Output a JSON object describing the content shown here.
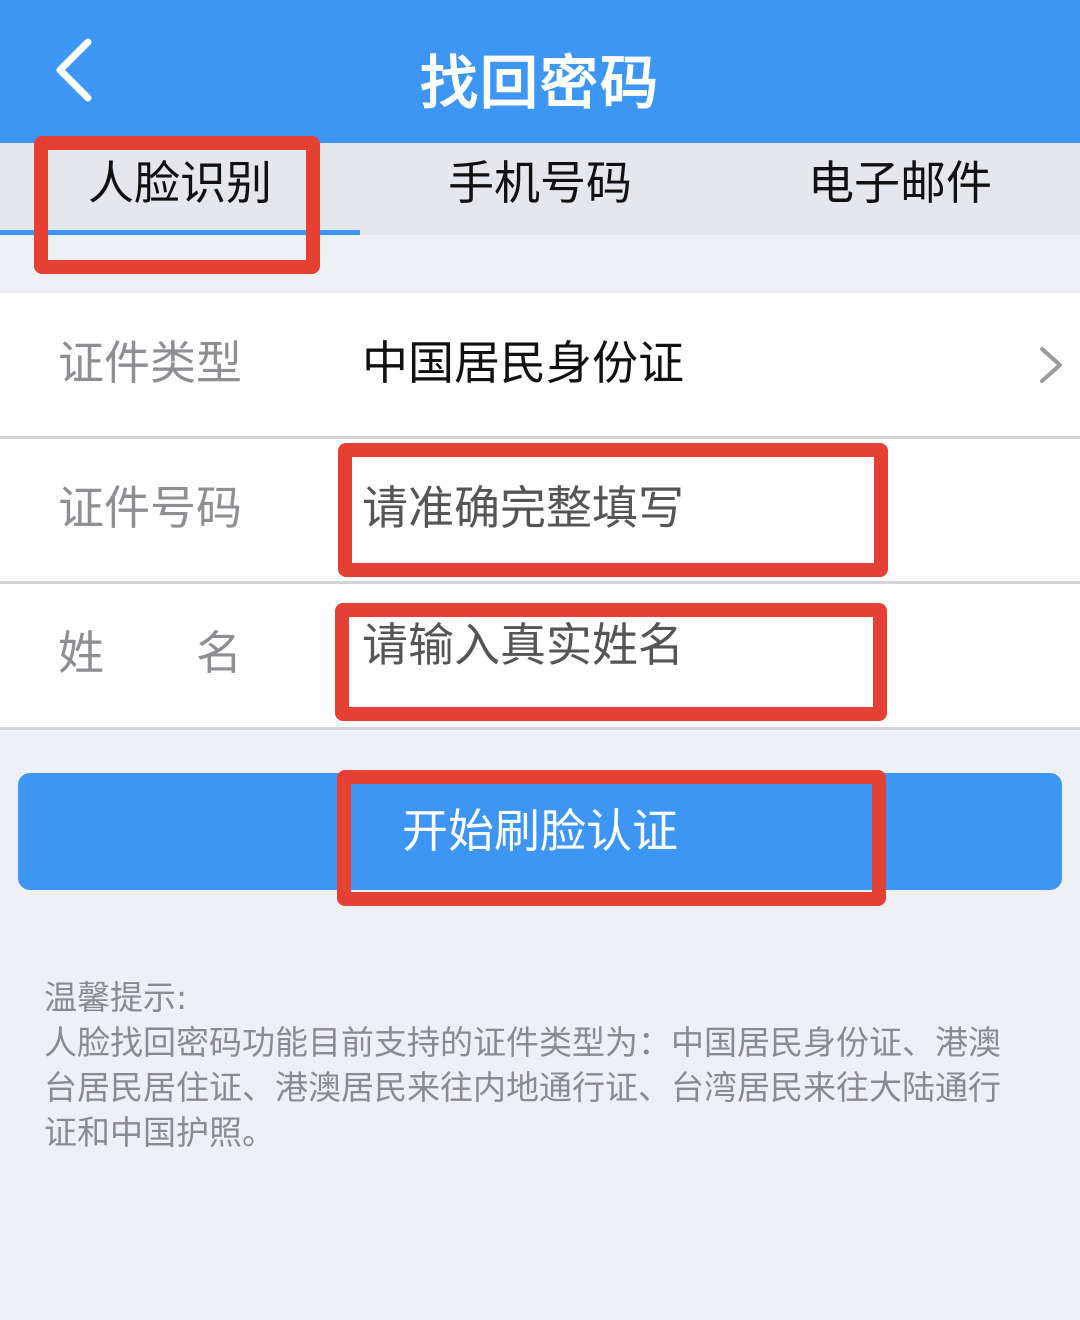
{
  "header": {
    "title": "找回密码"
  },
  "tabs": [
    {
      "label": "人脸识别",
      "active": true
    },
    {
      "label": "手机号码",
      "active": false
    },
    {
      "label": "电子邮件",
      "active": false
    }
  ],
  "form": {
    "id_type": {
      "label": "证件类型",
      "value": "中国居民身份证"
    },
    "id_number": {
      "label": "证件号码",
      "placeholder": "请准确完整填写"
    },
    "name": {
      "label": "姓　　名",
      "placeholder": "请输入真实姓名"
    }
  },
  "action": {
    "start_label": "开始刷脸认证"
  },
  "tips": {
    "heading": "温馨提示:",
    "body": "人脸找回密码功能目前支持的证件类型为：中国居民身份证、港澳台居民居住证、港澳居民来往内地通行证、台湾居民来往大陆通行证和中国护照。"
  },
  "colors": {
    "accent": "#3d96f4",
    "highlight": "#e54034",
    "background": "#eff0f5"
  },
  "icons": {
    "back": "chevron-left-icon",
    "row_arrow": "chevron-right-icon"
  }
}
